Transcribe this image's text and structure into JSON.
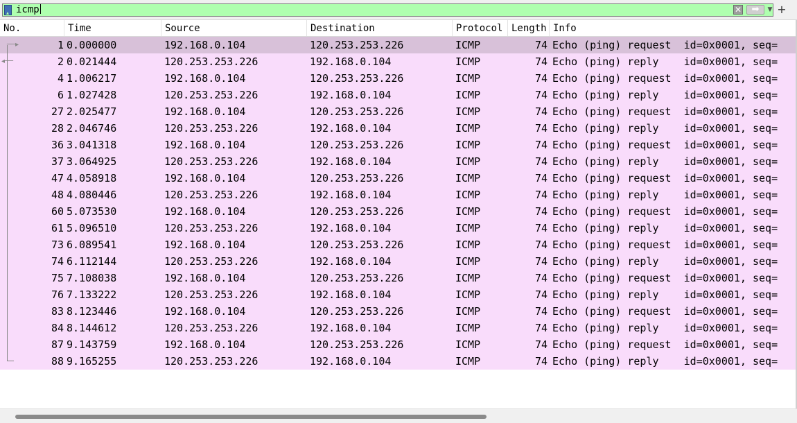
{
  "filter": {
    "value": "icmp"
  },
  "columns": [
    "No.",
    "Time",
    "Source",
    "Destination",
    "Protocol",
    "Length",
    "Info"
  ],
  "packets": [
    {
      "no": "1",
      "time": "0.000000",
      "src": "192.168.0.104",
      "dst": "120.253.253.226",
      "proto": "ICMP",
      "len": "74",
      "info": "Echo (ping) request  id=0x0001, seq="
    },
    {
      "no": "2",
      "time": "0.021444",
      "src": "120.253.253.226",
      "dst": "192.168.0.104",
      "proto": "ICMP",
      "len": "74",
      "info": "Echo (ping) reply    id=0x0001, seq="
    },
    {
      "no": "4",
      "time": "1.006217",
      "src": "192.168.0.104",
      "dst": "120.253.253.226",
      "proto": "ICMP",
      "len": "74",
      "info": "Echo (ping) request  id=0x0001, seq="
    },
    {
      "no": "6",
      "time": "1.027428",
      "src": "120.253.253.226",
      "dst": "192.168.0.104",
      "proto": "ICMP",
      "len": "74",
      "info": "Echo (ping) reply    id=0x0001, seq="
    },
    {
      "no": "27",
      "time": "2.025477",
      "src": "192.168.0.104",
      "dst": "120.253.253.226",
      "proto": "ICMP",
      "len": "74",
      "info": "Echo (ping) request  id=0x0001, seq="
    },
    {
      "no": "28",
      "time": "2.046746",
      "src": "120.253.253.226",
      "dst": "192.168.0.104",
      "proto": "ICMP",
      "len": "74",
      "info": "Echo (ping) reply    id=0x0001, seq="
    },
    {
      "no": "36",
      "time": "3.041318",
      "src": "192.168.0.104",
      "dst": "120.253.253.226",
      "proto": "ICMP",
      "len": "74",
      "info": "Echo (ping) request  id=0x0001, seq="
    },
    {
      "no": "37",
      "time": "3.064925",
      "src": "120.253.253.226",
      "dst": "192.168.0.104",
      "proto": "ICMP",
      "len": "74",
      "info": "Echo (ping) reply    id=0x0001, seq="
    },
    {
      "no": "47",
      "time": "4.058918",
      "src": "192.168.0.104",
      "dst": "120.253.253.226",
      "proto": "ICMP",
      "len": "74",
      "info": "Echo (ping) request  id=0x0001, seq="
    },
    {
      "no": "48",
      "time": "4.080446",
      "src": "120.253.253.226",
      "dst": "192.168.0.104",
      "proto": "ICMP",
      "len": "74",
      "info": "Echo (ping) reply    id=0x0001, seq="
    },
    {
      "no": "60",
      "time": "5.073530",
      "src": "192.168.0.104",
      "dst": "120.253.253.226",
      "proto": "ICMP",
      "len": "74",
      "info": "Echo (ping) request  id=0x0001, seq="
    },
    {
      "no": "61",
      "time": "5.096510",
      "src": "120.253.253.226",
      "dst": "192.168.0.104",
      "proto": "ICMP",
      "len": "74",
      "info": "Echo (ping) reply    id=0x0001, seq="
    },
    {
      "no": "73",
      "time": "6.089541",
      "src": "192.168.0.104",
      "dst": "120.253.253.226",
      "proto": "ICMP",
      "len": "74",
      "info": "Echo (ping) request  id=0x0001, seq="
    },
    {
      "no": "74",
      "time": "6.112144",
      "src": "120.253.253.226",
      "dst": "192.168.0.104",
      "proto": "ICMP",
      "len": "74",
      "info": "Echo (ping) reply    id=0x0001, seq="
    },
    {
      "no": "75",
      "time": "7.108038",
      "src": "192.168.0.104",
      "dst": "120.253.253.226",
      "proto": "ICMP",
      "len": "74",
      "info": "Echo (ping) request  id=0x0001, seq="
    },
    {
      "no": "76",
      "time": "7.133222",
      "src": "120.253.253.226",
      "dst": "192.168.0.104",
      "proto": "ICMP",
      "len": "74",
      "info": "Echo (ping) reply    id=0x0001, seq="
    },
    {
      "no": "83",
      "time": "8.123446",
      "src": "192.168.0.104",
      "dst": "120.253.253.226",
      "proto": "ICMP",
      "len": "74",
      "info": "Echo (ping) request  id=0x0001, seq="
    },
    {
      "no": "84",
      "time": "8.144612",
      "src": "120.253.253.226",
      "dst": "192.168.0.104",
      "proto": "ICMP",
      "len": "74",
      "info": "Echo (ping) reply    id=0x0001, seq="
    },
    {
      "no": "87",
      "time": "9.143759",
      "src": "192.168.0.104",
      "dst": "120.253.253.226",
      "proto": "ICMP",
      "len": "74",
      "info": "Echo (ping) request  id=0x0001, seq="
    },
    {
      "no": "88",
      "time": "9.165255",
      "src": "120.253.253.226",
      "dst": "192.168.0.104",
      "proto": "ICMP",
      "len": "74",
      "info": "Echo (ping) reply    id=0x0001, seq="
    }
  ],
  "colors": {
    "filter_ok": "#afffaf",
    "icmp_row": "#f9dcfb",
    "selected_row": "#d8c1d9"
  },
  "icons": {
    "bookmark": "bookmark-icon",
    "clear": "clear-icon",
    "apply": "apply-arrow-icon",
    "dropdown": "chevron-down-icon",
    "add": "plus-icon"
  }
}
